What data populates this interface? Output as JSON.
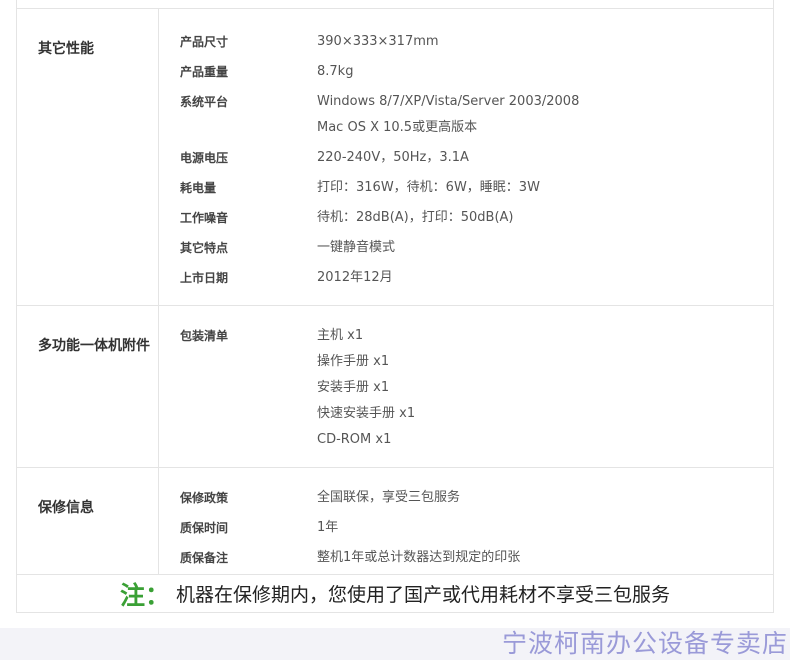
{
  "sections": [
    {
      "title": "其它性能",
      "rows": [
        {
          "label": "产品尺寸",
          "values": [
            "390×333×317mm"
          ]
        },
        {
          "label": "产品重量",
          "values": [
            "8.7kg"
          ]
        },
        {
          "label": "系统平台",
          "values": [
            "Windows 8/7/XP/Vista/Server 2003/2008",
            "Mac OS X 10.5或更高版本"
          ]
        },
        {
          "label": "电源电压",
          "values": [
            "220-240V，50Hz，3.1A"
          ]
        },
        {
          "label": "耗电量",
          "values": [
            "打印：316W，待机：6W，睡眠：3W"
          ]
        },
        {
          "label": "工作噪音",
          "values": [
            "待机：28dB(A)，打印：50dB(A)"
          ]
        },
        {
          "label": "其它特点",
          "values": [
            "一键静音模式"
          ]
        },
        {
          "label": "上市日期",
          "values": [
            "2012年12月"
          ]
        }
      ]
    },
    {
      "title": "多功能一体机附件",
      "rows": [
        {
          "label": "包装清单",
          "values": [
            "主机 x1",
            "操作手册 x1",
            "安装手册 x1",
            "快速安装手册 x1",
            "CD-ROM x1"
          ]
        }
      ]
    },
    {
      "title": "保修信息",
      "rows": [
        {
          "label": "保修政策",
          "values": [
            "全国联保，享受三包服务"
          ]
        },
        {
          "label": "质保时间",
          "values": [
            "1年"
          ]
        },
        {
          "label": "质保备注",
          "values": [
            "整机1年或总计数器达到规定的印张"
          ]
        }
      ]
    }
  ],
  "note": {
    "label": "注：",
    "text": "机器在保修期内，您使用了国产或代用耗材不享受三包服务"
  },
  "footer": {
    "store_name": "宁波柯南办公设备专卖店"
  }
}
